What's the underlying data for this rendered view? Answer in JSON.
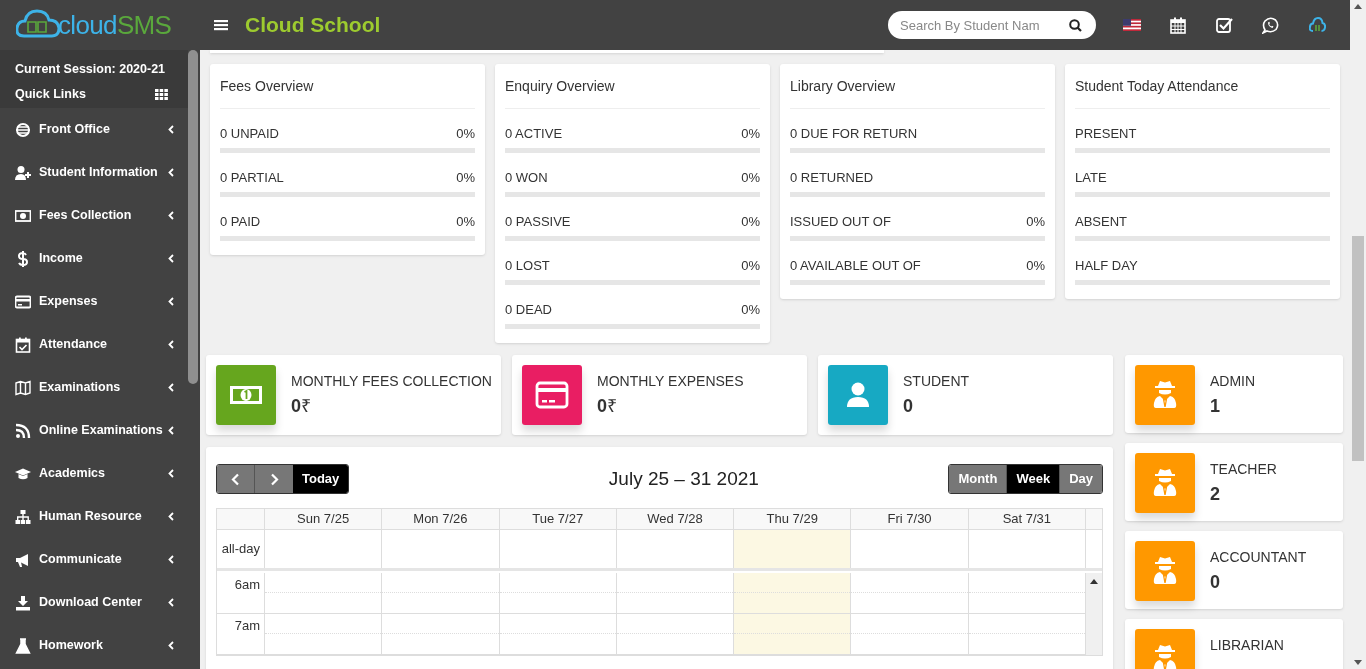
{
  "header": {
    "logo": {
      "word_1": "cloud",
      "word_2": "SMS"
    },
    "school_name": "Cloud School",
    "search": {
      "placeholder": "Search By Student Nam"
    }
  },
  "sidebar": {
    "session": "Current Session: 2020-21",
    "quick_links": "Quick Links",
    "items": [
      {
        "label": "Front Office",
        "kind": "globe"
      },
      {
        "label": "Student Information",
        "kind": "user-plus"
      },
      {
        "label": "Fees Collection",
        "kind": "money"
      },
      {
        "label": "Income",
        "kind": "dollar"
      },
      {
        "label": "Expenses",
        "kind": "card"
      },
      {
        "label": "Attendance",
        "kind": "calendar-check"
      },
      {
        "label": "Examinations",
        "kind": "map"
      },
      {
        "label": "Online Examinations",
        "kind": "rss"
      },
      {
        "label": "Academics",
        "kind": "cap"
      },
      {
        "label": "Human Resource",
        "kind": "sitemap"
      },
      {
        "label": "Communicate",
        "kind": "bullhorn"
      },
      {
        "label": "Download Center",
        "kind": "download"
      },
      {
        "label": "Homework",
        "kind": "flask"
      }
    ]
  },
  "overview_cards": [
    {
      "title": "Fees Overview",
      "rows": [
        {
          "label": "0 UNPAID",
          "percent": "0%",
          "level": 0
        },
        {
          "label": "0 PARTIAL",
          "percent": "0%",
          "level": 0
        },
        {
          "label": "0 PAID",
          "percent": "0%",
          "level": 0
        }
      ]
    },
    {
      "title": "Enquiry Overview",
      "rows": [
        {
          "label": "0 ACTIVE",
          "percent": "0%",
          "level": 0
        },
        {
          "label": "0 WON",
          "percent": "0%",
          "level": 0
        },
        {
          "label": "0 PASSIVE",
          "percent": "0%",
          "level": 0
        },
        {
          "label": "0 LOST",
          "percent": "0%",
          "level": 0
        },
        {
          "label": "0 DEAD",
          "percent": "0%",
          "level": 0
        }
      ]
    },
    {
      "title": "Library Overview",
      "rows": [
        {
          "label": "0 DUE FOR RETURN",
          "level": 0
        },
        {
          "label": "0 RETURNED",
          "level": 0
        },
        {
          "label": "ISSUED OUT OF",
          "percent": "0%",
          "level": 0
        },
        {
          "label": "0 AVAILABLE OUT OF",
          "percent": "0%",
          "level": 0
        }
      ]
    },
    {
      "title": "Student Today Attendance",
      "rows": [
        {
          "label": "PRESENT",
          "level": 0
        },
        {
          "label": "LATE",
          "level": 0
        },
        {
          "label": "ABSENT",
          "level": 0
        },
        {
          "label": "HALF DAY",
          "level": 0
        }
      ]
    }
  ],
  "stat_cards": [
    {
      "label": "MONTHLY FEES COLLECTION",
      "value": "**0**₹",
      "kind": "money",
      "color": "#66a61e"
    },
    {
      "label": "MONTHLY EXPENSES",
      "value": "**0**₹",
      "kind": "card",
      "color": "#e91e63"
    },
    {
      "label": "STUDENT",
      "value": "**0**",
      "kind": "user",
      "color": "#17a9c3"
    }
  ],
  "staff_cards": [
    {
      "label": "ADMIN",
      "value": "1",
      "color": "#ff9800"
    },
    {
      "label": "TEACHER",
      "value": "2",
      "color": "#ff9800"
    },
    {
      "label": "ACCOUNTANT",
      "value": "0",
      "color": "#ff9800"
    },
    {
      "label": "LIBRARIAN",
      "color": "#ff9800"
    }
  ],
  "calendar": {
    "today_button": "Today",
    "title": "July 25 – 31 2021",
    "views": [
      {
        "label": "Month",
        "selected": false
      },
      {
        "label": "Week",
        "selected": true
      },
      {
        "label": "Day",
        "selected": false
      }
    ],
    "columns": [
      {
        "label": "Sun 7/25",
        "today": false
      },
      {
        "label": "Mon 7/26",
        "today": false
      },
      {
        "label": "Tue 7/27",
        "today": false
      },
      {
        "label": "Wed 7/28",
        "today": false
      },
      {
        "label": "Thu 7/29",
        "today": true
      },
      {
        "label": "Fri 7/30",
        "today": false
      },
      {
        "label": "Sat 7/31",
        "today": false
      }
    ],
    "all_day_label": "all-day",
    "times": [
      "6am",
      "7am"
    ]
  }
}
